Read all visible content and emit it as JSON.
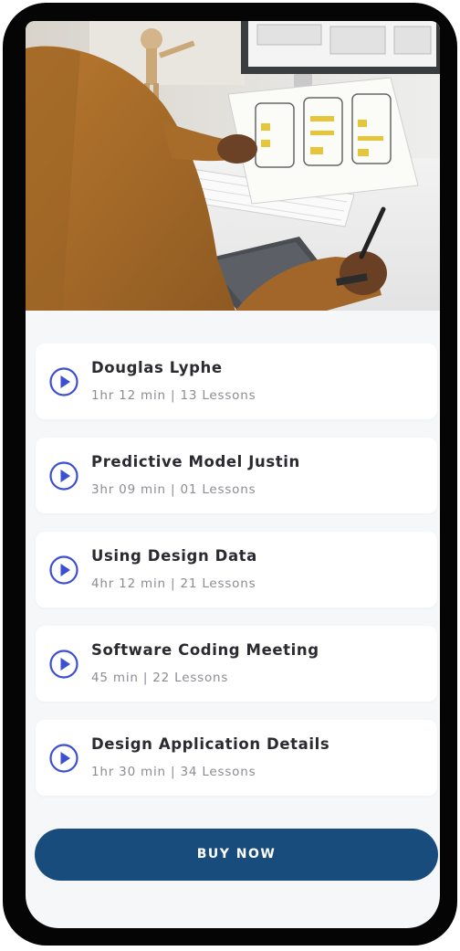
{
  "hero": {
    "image": "designer-wireframe-sketch-photo",
    "icon": "hero-photo"
  },
  "lessons": [
    {
      "title": "Douglas Lyphe",
      "meta": "1hr 12 min | 13 Lessons",
      "icon": "play-circle-icon"
    },
    {
      "title": "Predictive Model Justin",
      "meta": "3hr 09 min | 01 Lessons",
      "icon": "play-circle-icon"
    },
    {
      "title": "Using Design Data",
      "meta": "4hr 12 min | 21 Lessons",
      "icon": "play-circle-icon"
    },
    {
      "title": "Software Coding Meeting",
      "meta": "45 min | 22 Lessons",
      "icon": "play-circle-icon"
    },
    {
      "title": "Design Application Details",
      "meta": "1hr 30 min | 34 Lessons",
      "icon": "play-circle-icon"
    }
  ],
  "buy": {
    "label": "BUY NOW"
  },
  "colors": {
    "accent": "#3d4fd1",
    "button": "#174c7d",
    "background": "#f6f7f9",
    "frame": "#050505"
  }
}
